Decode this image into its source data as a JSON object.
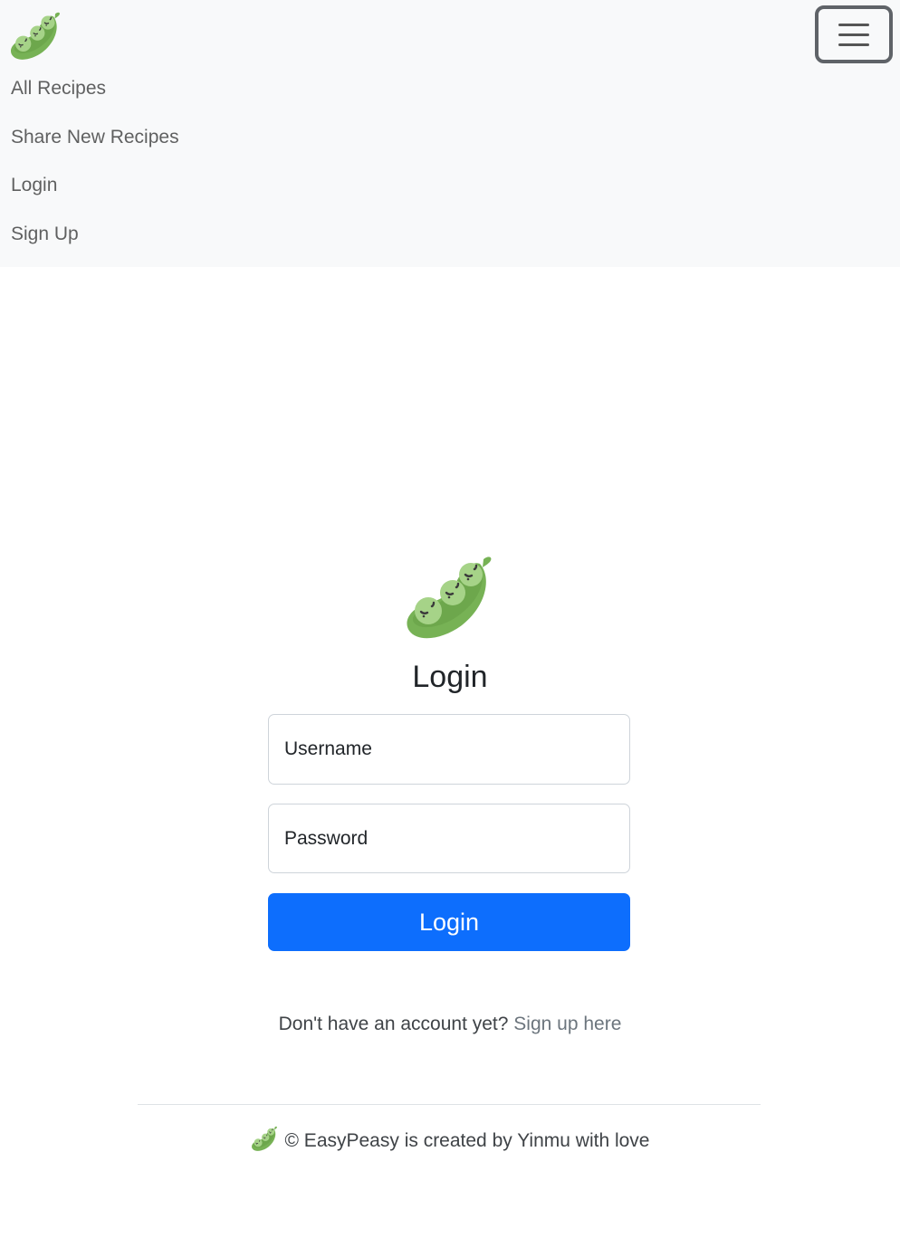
{
  "nav": {
    "brand_icon": "pea-pod-icon",
    "toggler_icon": "hamburger-menu-icon",
    "links": [
      "All Recipes",
      "Share New Recipes",
      "Login",
      "Sign Up"
    ]
  },
  "login_form": {
    "logo_icon": "pea-pod-icon",
    "title": "Login",
    "username_placeholder": "Username",
    "password_placeholder": "Password",
    "submit_label": "Login",
    "signup_prompt": "Don't have an account yet?",
    "signup_link": "Sign up here"
  },
  "footer": {
    "logo_icon": "pea-pod-icon",
    "text": "© EasyPeasy is created by Yinmu with love"
  },
  "colors": {
    "primary": "#0d6efd",
    "navbar_bg": "#f8f9fa",
    "pea_green": "#77b255",
    "pea_light": "#a6d388"
  }
}
